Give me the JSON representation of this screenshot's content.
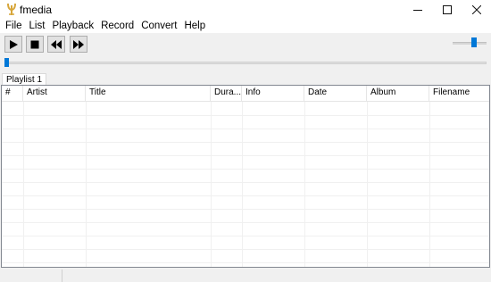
{
  "window": {
    "title": "fmedia",
    "minimize_glyph": "—",
    "maximize_glyph": "☐",
    "close_glyph": "✕"
  },
  "menu": [
    "File",
    "List",
    "Playback",
    "Record",
    "Convert",
    "Help"
  ],
  "toolbar": {
    "buttons": [
      "play-icon",
      "stop-icon",
      "rewind-icon",
      "fast-forward-icon"
    ]
  },
  "volume": {
    "level": 0.6
  },
  "seek": {
    "position": 0.0
  },
  "tabs": [
    {
      "label": "Playlist 1"
    }
  ],
  "playlist": {
    "columns": [
      "#",
      "Artist",
      "Title",
      "Dura...",
      "Info",
      "Date",
      "Album",
      "Filename"
    ],
    "rows": []
  },
  "colors": {
    "accent": "#0078d7",
    "icon": "#d7a63a"
  }
}
